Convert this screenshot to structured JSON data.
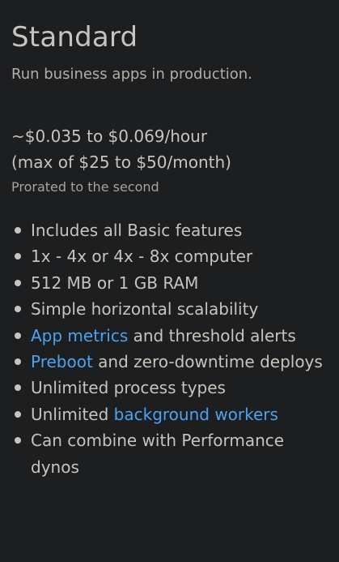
{
  "plan": {
    "title": "Standard",
    "subtitle": "Run business apps in production.",
    "price_hourly": "~$0.035 to $0.069/hour",
    "price_monthly": "(max of $25 to $50/month)",
    "prorated": "Prorated to the second"
  },
  "features": [
    {
      "text": "Includes all Basic features"
    },
    {
      "text": "1x - 4x or 4x - 8x computer"
    },
    {
      "text": "512 MB or 1 GB RAM"
    },
    {
      "text": "Simple horizontal scalability"
    },
    {
      "link": "App metrics",
      "text": " and threshold alerts"
    },
    {
      "link": "Preboot",
      "text": " and zero-downtime deploys"
    },
    {
      "text": "Unlimited process types"
    },
    {
      "text": "Unlimited ",
      "link": "background workers"
    },
    {
      "text": "Can combine with Performance dynos"
    }
  ],
  "colors": {
    "background": "#1c1e20",
    "text": "#c8c4bd",
    "link": "#4aa3f0"
  }
}
